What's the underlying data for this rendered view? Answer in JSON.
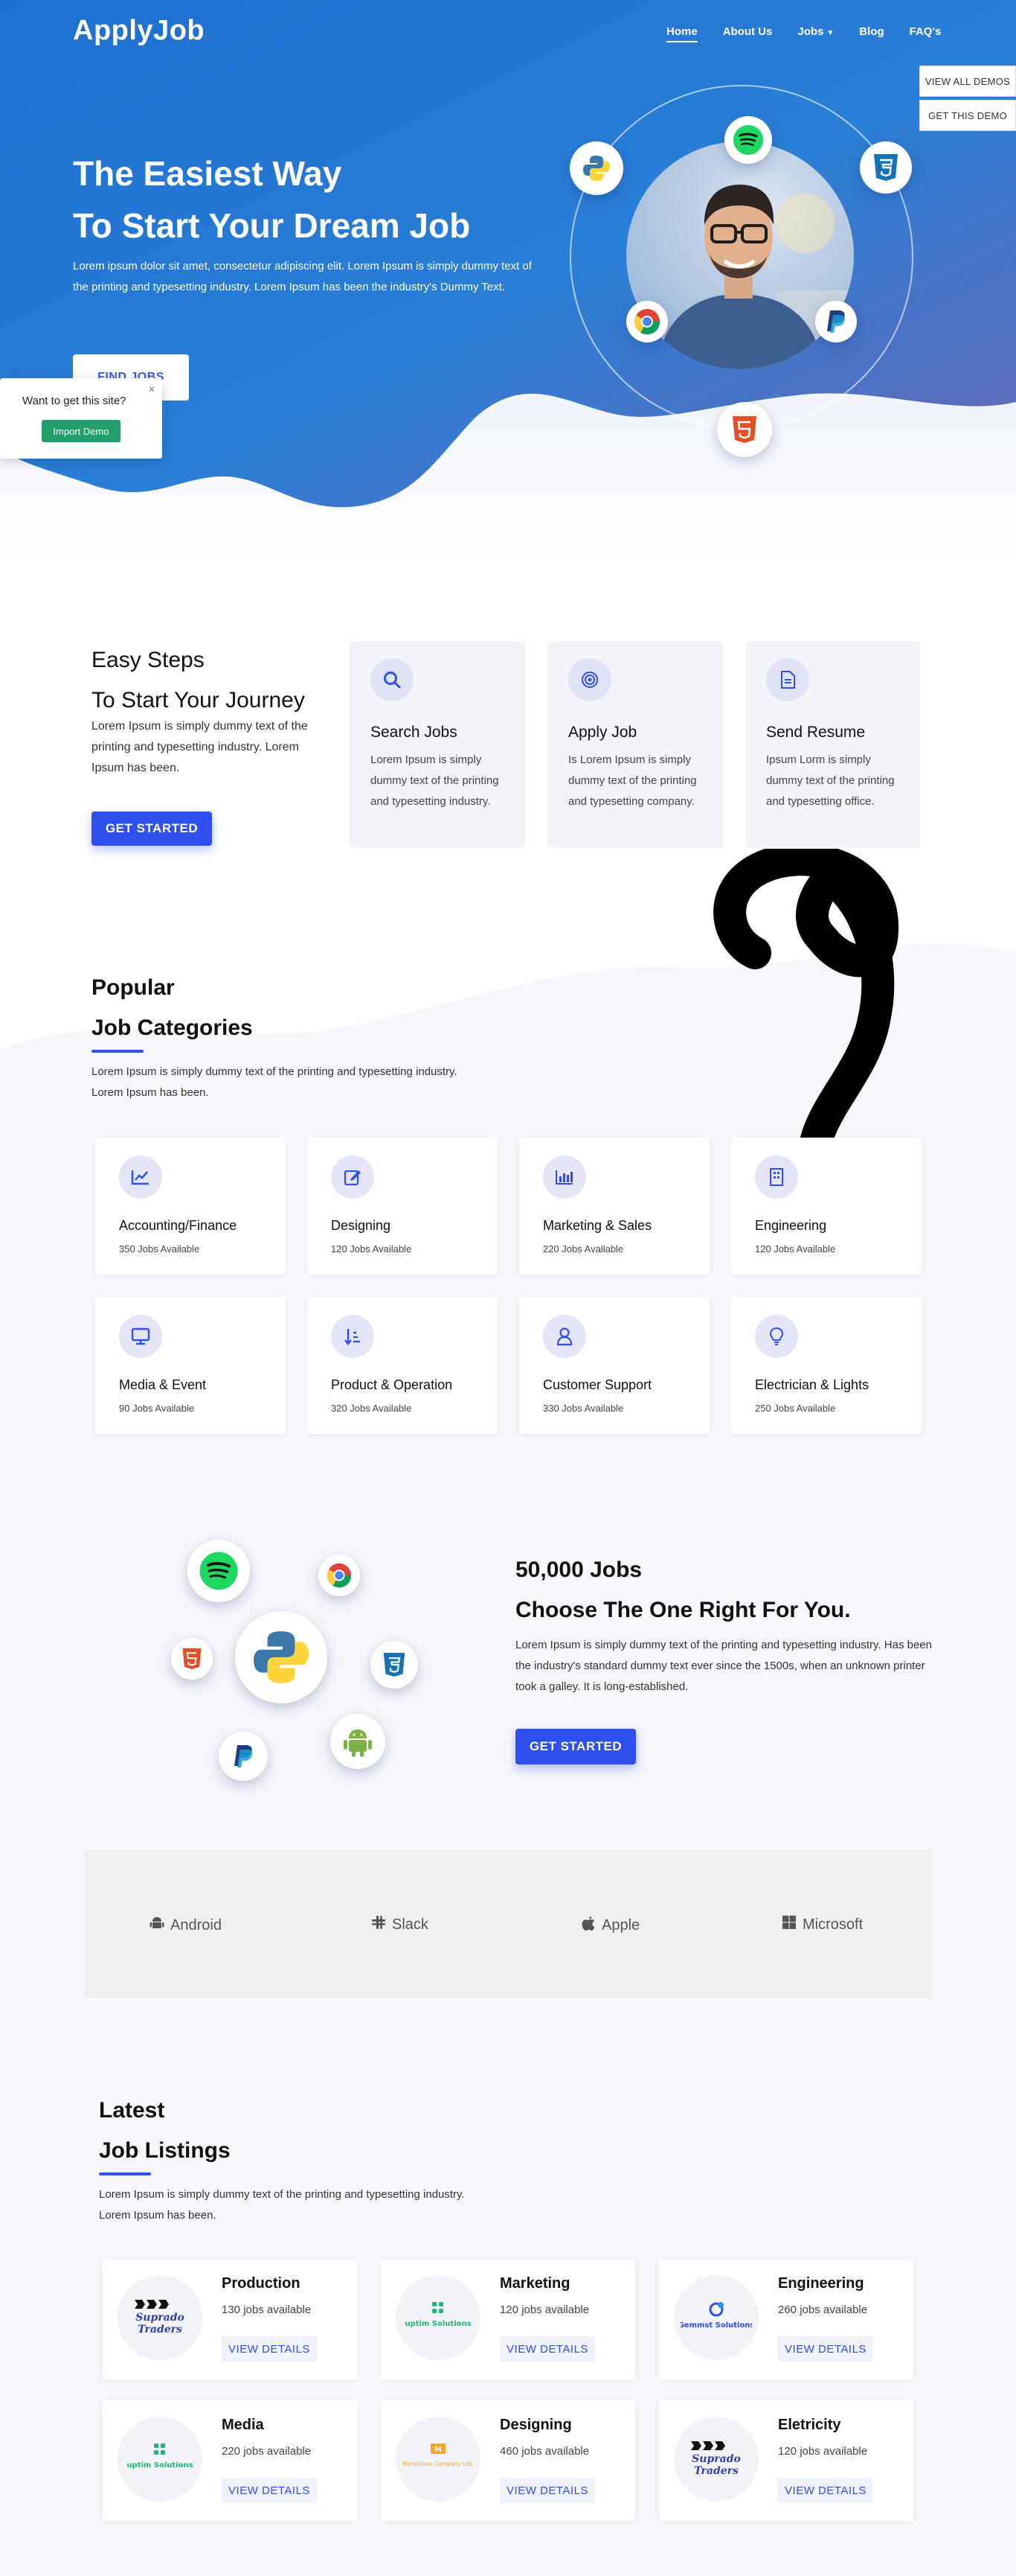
{
  "header": {
    "logo": "ApplyJob",
    "nav": [
      "Home",
      "About Us",
      "Jobs",
      "Blog",
      "FAQ's"
    ],
    "demo_buttons": [
      "VIEW ALL DEMOS",
      "GET THIS DEMO"
    ]
  },
  "hero": {
    "title_line1": "The Easiest Way",
    "title_line2": "To Start Your Dream Job",
    "text": "Lorem ipsum dolor sit amet, consectetur adipiscing elit. Lorem Ipsum is simply dummy text of the printing and typesetting industry. Lorem Ipsum has been the industry's Dummy Text.",
    "cta": "FIND JOBS"
  },
  "popup": {
    "text": "Want to get this site?",
    "button": "Import Demo"
  },
  "steps": {
    "title_line1": "Easy Steps",
    "title_line2": "To Start Your Journey",
    "text": "Lorem Ipsum is simply dummy text of the printing and typesetting industry. Lorem Ipsum has been.",
    "cta": "GET STARTED",
    "cards": [
      {
        "title": "Search Jobs",
        "text": "Lorem Ipsum is simply dummy text of the printing and typesetting industry."
      },
      {
        "title": "Apply Job",
        "text": "Is Lorem Ipsum is simply dummy text of the printing and typesetting company."
      },
      {
        "title": "Send Resume",
        "text": "Ipsum Lorm is simply dummy text of the printing and typesetting office."
      }
    ]
  },
  "categories": {
    "title_line1": "Popular",
    "title_line2": "Job Categories",
    "text": "Lorem Ipsum is simply dummy text of the printing and typesetting industry. Lorem Ipsum has been.",
    "items": [
      {
        "name": "Accounting/Finance",
        "count": "350 Jobs Available"
      },
      {
        "name": "Designing",
        "count": "120 Jobs Available"
      },
      {
        "name": "Marketing & Sales",
        "count": "220 Jobs Available"
      },
      {
        "name": "Engineering",
        "count": "120 Jobs Available"
      },
      {
        "name": "Media & Event",
        "count": "90 Jobs Available"
      },
      {
        "name": "Product & Operation",
        "count": "320 Jobs Available"
      },
      {
        "name": "Customer Support",
        "count": "330 Jobs Available"
      },
      {
        "name": "Electrician & Lights",
        "count": "250 Jobs Available"
      }
    ]
  },
  "jobs_promo": {
    "title_line1": "50,000 Jobs",
    "title_line2": "Choose The One Right For You.",
    "text": "Lorem Ipsum is simply dummy text of the printing and typesetting industry. Has been the industry's standard dummy text ever since the 1500s, when an unknown printer took a galley. It is long-established.",
    "cta": "GET STARTED"
  },
  "brands": [
    "Android",
    "Slack",
    "Apple",
    "Microsoft"
  ],
  "listings": {
    "title_line1": "Latest",
    "title_line2": "Job Listings",
    "text": "Lorem Ipsum is simply dummy text of the printing and typesetting industry. Lorem Ipsum has been.",
    "button_label": "VIEW DETAILS",
    "items": [
      {
        "title": "Production",
        "count": "130 jobs available",
        "company": "Suprado Traders"
      },
      {
        "title": "Marketing",
        "count": "120 jobs available",
        "company": "uptim Solutions"
      },
      {
        "title": "Engineering",
        "count": "260 jobs available",
        "company": "Gemmst Solutions"
      },
      {
        "title": "Media",
        "count": "220 jobs available",
        "company": "uptim Solutions"
      },
      {
        "title": "Designing",
        "count": "460 jobs available",
        "company": "Marvellous Company Ltd."
      },
      {
        "title": "Eletricity",
        "count": "120 jobs available",
        "company": "Suprado Traders"
      }
    ]
  },
  "colors": {
    "primary": "#2f4ff0",
    "hero_start": "#1f6fd0",
    "hero_end": "#6a6ab8",
    "import_green": "#22a06b"
  }
}
